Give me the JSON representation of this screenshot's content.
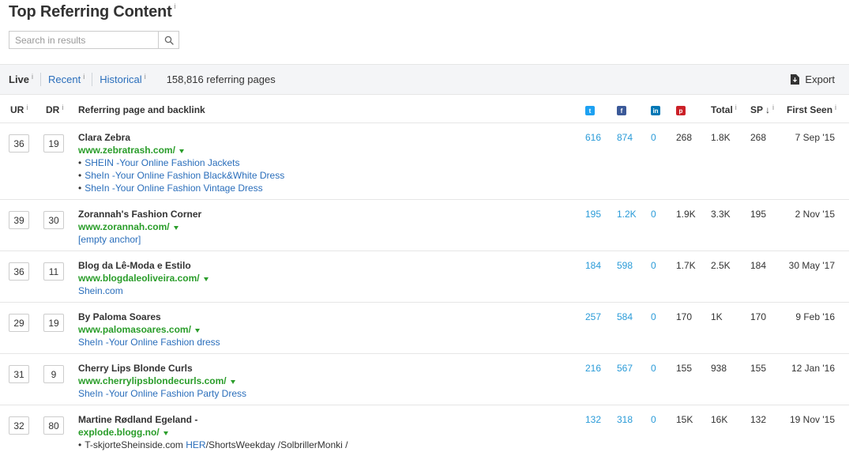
{
  "page": {
    "title": "Top Referring Content",
    "info_glyph": "i"
  },
  "search": {
    "placeholder": "Search in results"
  },
  "tabs": {
    "live": "Live",
    "recent": "Recent",
    "historical": "Historical",
    "count_text": "158,816 referring pages",
    "export": "Export"
  },
  "columns": {
    "ur": "UR",
    "dr": "DR",
    "referring": "Referring page and backlink",
    "twitter": "t",
    "facebook": "f",
    "linkedin": "in",
    "pinterest": "p",
    "total": "Total",
    "sp": "SP",
    "sort_arrow": "↓",
    "first_seen": "First Seen"
  },
  "colors": {
    "twitter": "#1da1f2",
    "facebook": "#3b5998",
    "linkedin": "#0077b5",
    "pinterest": "#cb2027",
    "link_blue": "#2a6ebb",
    "url_green": "#2a9d2a"
  },
  "rows": [
    {
      "ur": "36",
      "dr": "19",
      "title": "Clara Zebra",
      "url": "www.zebratrash.com/",
      "links": [
        "SHEIN -Your Online Fashion Jackets",
        "SheIn -Your Online Fashion Black&White Dress",
        "SheIn -Your Online Fashion Vintage Dress"
      ],
      "twitter": "616",
      "facebook": "874",
      "linkedin": "0",
      "pinterest": "268",
      "total": "1.8K",
      "sp": "268",
      "first_seen": "7 Sep '15"
    },
    {
      "ur": "39",
      "dr": "30",
      "title": "Zorannah's Fashion Corner",
      "url": "www.zorannah.com/",
      "links": [
        "[empty anchor]"
      ],
      "twitter": "195",
      "facebook": "1.2K",
      "linkedin": "0",
      "pinterest": "1.9K",
      "total": "3.3K",
      "sp": "195",
      "first_seen": "2 Nov '15"
    },
    {
      "ur": "36",
      "dr": "11",
      "title": "Blog da Lê-Moda e Estilo",
      "url": "www.blogdaleoliveira.com/",
      "links": [
        "Shein.com"
      ],
      "twitter": "184",
      "facebook": "598",
      "linkedin": "0",
      "pinterest": "1.7K",
      "total": "2.5K",
      "sp": "184",
      "first_seen": "30 May '17"
    },
    {
      "ur": "29",
      "dr": "19",
      "title": "By Paloma Soares",
      "url": "www.palomasoares.com/",
      "links": [
        "SheIn -Your Online Fashion dress"
      ],
      "twitter": "257",
      "facebook": "584",
      "linkedin": "0",
      "pinterest": "170",
      "total": "1K",
      "sp": "170",
      "first_seen": "9 Feb '16"
    },
    {
      "ur": "31",
      "dr": "9",
      "title": "Cherry Lips Blonde Curls",
      "url": "www.cherrylipsblondecurls.com/",
      "links": [
        "SheIn -Your Online Fashion Party Dress"
      ],
      "twitter": "216",
      "facebook": "567",
      "linkedin": "0",
      "pinterest": "155",
      "total": "938",
      "sp": "155",
      "first_seen": "12 Jan '16"
    },
    {
      "ur": "32",
      "dr": "80",
      "title": "Martine Rødland Egeland -",
      "url": "explode.blogg.no/",
      "anchor_prefix": "T-skjorteSheinside.com",
      "anchor_link": "HER",
      "anchor_suffix": "/ShortsWeekday /SolbrillerMonki /",
      "twitter": "132",
      "facebook": "318",
      "linkedin": "0",
      "pinterest": "15K",
      "total": "16K",
      "sp": "132",
      "first_seen": "19 Nov '15"
    }
  ]
}
